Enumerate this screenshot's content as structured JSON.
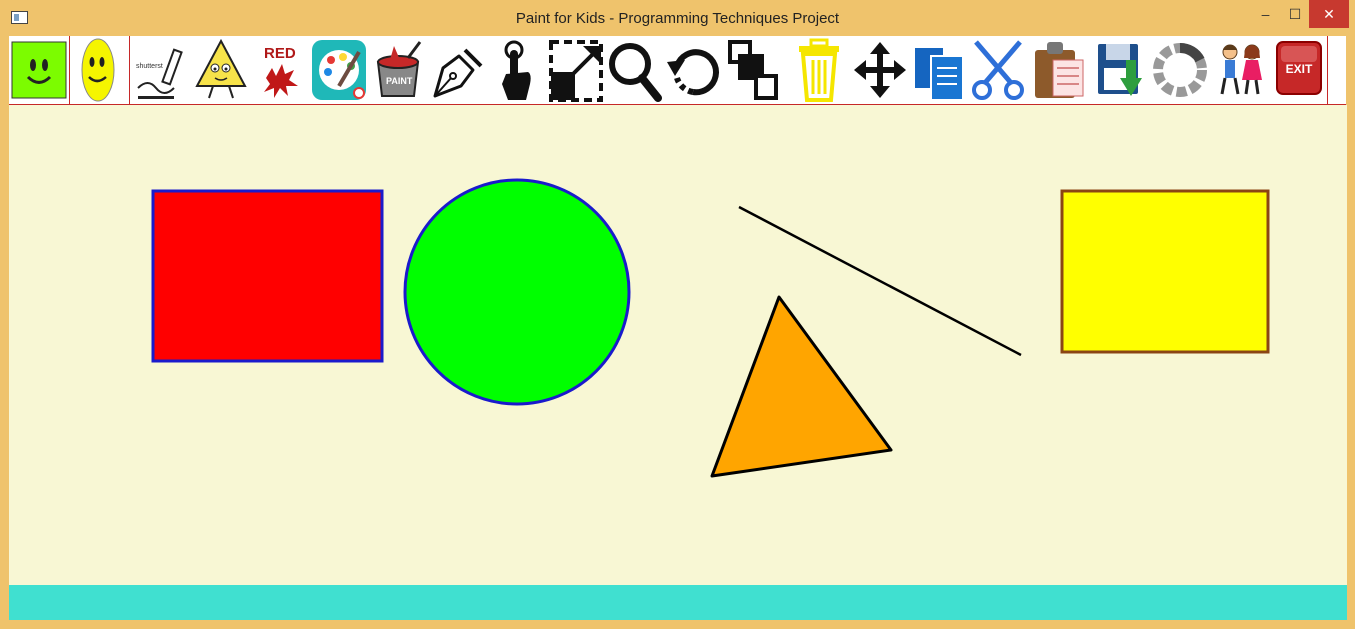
{
  "window": {
    "title": "Paint for Kids - Programming Techniques Project",
    "controls": {
      "minimize": "–",
      "maximize": "☐",
      "close": "✕"
    }
  },
  "toolbar": {
    "mode_icons": [
      "draw-mode-icon",
      "play-mode-icon"
    ],
    "tools": [
      "shapes-tool-icon",
      "triangle-tool-icon",
      "color-tool-icon",
      "palette-tool-icon",
      "fill-bucket-tool-icon",
      "pen-tool-icon",
      "select-tool-icon",
      "resize-tool-icon",
      "zoom-tool-icon",
      "rotate-tool-icon",
      "send-back-tool-icon",
      "delete-tool-icon",
      "move-tool-icon",
      "copy-tool-icon",
      "cut-tool-icon",
      "paste-tool-icon",
      "save-tool-icon",
      "load-tool-icon",
      "kids-play-icon",
      "exit-icon"
    ],
    "red_label": "RED",
    "exit_label": "EXIT"
  },
  "colors": {
    "title_bar": "#efc36c",
    "toolbar_bg": "#ffffff",
    "toolbar_border": "#c62828",
    "canvas_bg": "#f8f7d4",
    "status_bar": "#40e0d0"
  },
  "canvas": {
    "shapes": [
      {
        "type": "rectangle",
        "fill": "#ff0000",
        "stroke": "#1a1acc"
      },
      {
        "type": "circle",
        "fill": "#00ff00",
        "stroke": "#1a1acc"
      },
      {
        "type": "line",
        "stroke": "#000000"
      },
      {
        "type": "triangle",
        "fill": "#ffa500",
        "stroke": "#000000"
      },
      {
        "type": "rectangle",
        "fill": "#ffff00",
        "stroke": "#8b4513"
      }
    ]
  },
  "statusbar": {
    "text": ""
  }
}
